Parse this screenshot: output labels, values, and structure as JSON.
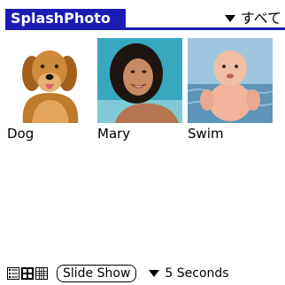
{
  "app": {
    "title": "SplashPhoto",
    "category": "すべて"
  },
  "photos": [
    {
      "label": "Dog"
    },
    {
      "label": "Mary"
    },
    {
      "label": "Swim"
    }
  ],
  "bottom": {
    "slideshow_label": "Slide Show",
    "interval_label": "5 Seconds"
  },
  "colors": {
    "accent": "#1c1cb4"
  }
}
